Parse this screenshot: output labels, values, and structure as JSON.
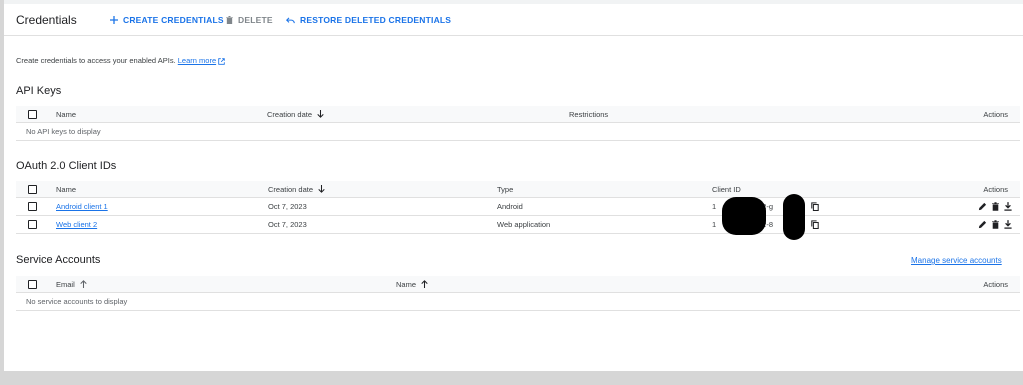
{
  "header": {
    "title": "Credentials",
    "create_label": "CREATE CREDENTIALS",
    "delete_label": "DELETE",
    "restore_label": "RESTORE DELETED CREDENTIALS"
  },
  "intro": {
    "text": "Create credentials to access your enabled APIs.",
    "link": "Learn more"
  },
  "api_keys": {
    "title": "API Keys",
    "columns": {
      "name": "Name",
      "created": "Creation date",
      "restrictions": "Restrictions",
      "actions": "Actions"
    },
    "empty": "No API keys to display"
  },
  "oauth": {
    "title": "OAuth 2.0 Client IDs",
    "columns": {
      "name": "Name",
      "created": "Creation date",
      "type": "Type",
      "client_id": "Client ID",
      "actions": "Actions"
    },
    "rows": [
      {
        "name": "Android client 1",
        "created": "Oct 7, 2023",
        "type": "Android",
        "client_id_start": "1",
        "client_id_mid": "12-g"
      },
      {
        "name": "Web client 2",
        "created": "Oct 7, 2023",
        "type": "Web application",
        "client_id_start": "1",
        "client_id_mid": "12-8"
      }
    ]
  },
  "service_accounts": {
    "title": "Service Accounts",
    "manage_link": "Manage service accounts",
    "columns": {
      "email": "Email",
      "name": "Name",
      "actions": "Actions"
    },
    "empty": "No service accounts to display"
  }
}
